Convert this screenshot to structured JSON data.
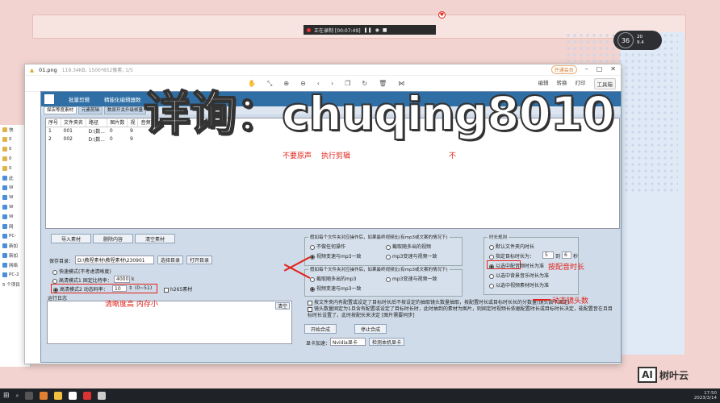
{
  "recorder": {
    "status": "正在录制 [00:07:49]"
  },
  "system_widget": {
    "value": "36",
    "up": "20",
    "down": "9.4"
  },
  "viewer": {
    "filename": "01.png",
    "meta": "119.34KB, 1500*852像素, 1/5",
    "badge": "开通会员",
    "tools": [
      "编辑",
      "转换",
      "打印",
      "工具箱"
    ]
  },
  "app": {
    "header": [
      "批量剪辑",
      "精能化编辑器数"
    ],
    "tabs": [
      "探店等度素材",
      "元素剪辑",
      "数原开关升级帧量"
    ],
    "table": {
      "columns": [
        "序号",
        "文件夹名",
        "路径",
        "图片数",
        "视",
        "音频数"
      ],
      "rows": [
        [
          "1",
          "001",
          "D:\\数...",
          "0",
          "9"
        ],
        [
          "2",
          "002",
          "D:\\数...",
          "0",
          "9"
        ]
      ]
    },
    "buttons": {
      "import": "导入素材",
      "clear_content": "删除内容",
      "clear_material": "清空素材",
      "choose_dir": "选择目录",
      "open_dir": "打开目录",
      "start": "开始合成",
      "stop": "停止合成",
      "clear": "清空",
      "check_gpu": "检测本机显卡"
    },
    "save_dir_label": "保存目录：",
    "save_dir_value": "D:\\教程素材\\教程素材\\230901",
    "modes": [
      {
        "label": "快速模式(不考虑清晰度)",
        "checked": false
      },
      {
        "label": "高清模式1 固定比特率：",
        "checked": false,
        "value": "4000",
        "unit": "k"
      },
      {
        "label": "高清模式2 动态码率：",
        "checked": true,
        "value": "10",
        "range": "(0~51)"
      }
    ],
    "h265": "h265素材",
    "log_label": "运行日志",
    "group1": {
      "title": "假如每个文件夹对应操作后，如果最终视频比(有mp3或文案的情况下)",
      "options": [
        "不做任何操作",
        "截取随多出的视频",
        "视频变速与mp3一致",
        "mp3变速与视频一致"
      ]
    },
    "group2": {
      "title": "假如每个文件夹对应操作后，如果最终视频比(有mp3或文案的情况下)",
      "options": [
        "截取随多出的mp3",
        "mp3变速与视频一致",
        "视频变速与mp3一致"
      ]
    },
    "duration": {
      "title": "时长规则",
      "options": [
        "默认文件夹内时长",
        "指定目标时长为：",
        "以选中配音",
        "以选中背景音乐时长为准",
        "以选中视频素材时长为准"
      ],
      "from": "5",
      "to_label": "到",
      "to": "6",
      "unit": "秒",
      "option3_suffix": "频时长为准"
    },
    "checks": [
      "按文件夹内有配置或设定了目标时长后不按设定的抽取镜头数量抽取，按配置时长或目标时长长的分数量(镜头数不固定)",
      "镜头数量固定为1且含有配置或设定了目标时长时，此时抽到的素材为图片，则固定时视频长依据配置时长或目标时长决定，能配置音在且目标时长设置了，此时按配长来决定 [图片需要同步]"
    ],
    "gpu_label": "显卡加速：",
    "gpu_value": "Nvidia显卡"
  },
  "annotations": {
    "no_sound": "不要原声",
    "execute": "执行剪辑",
    "partial": "不",
    "clarity": "清晰度高 内存小",
    "match_voice": "按配音时长",
    "dynamic_shots": "动态镜头数"
  },
  "watermark_overlay": "详询：chuqing8010",
  "left_window": {
    "items": [
      "快",
      "0",
      "0",
      "0",
      "0",
      "此",
      "W",
      "W",
      "W",
      "W",
      "网",
      "PC-",
      "新加",
      "新加",
      "网络",
      "PC-2"
    ],
    "status": "5 个项目"
  },
  "taskbar": {
    "time": "17:50",
    "date": "2023/3/14"
  },
  "brand": {
    "logo": "AI",
    "name": "树叶云"
  }
}
